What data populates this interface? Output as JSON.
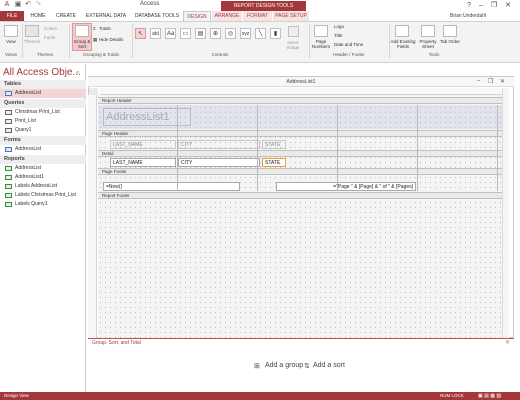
{
  "window": {
    "app_title": "Access",
    "tools_tab": "REPORT DESIGN TOOLS",
    "user": "Brian Underdahl",
    "help": "?"
  },
  "ribbon": {
    "tabs": [
      "FILE",
      "HOME",
      "CREATE",
      "EXTERNAL DATA",
      "DATABASE TOOLS",
      "DESIGN",
      "ARRANGE",
      "FORMAT",
      "PAGE SETUP"
    ],
    "groups": {
      "views": "Views",
      "themes": "Themes",
      "grouping": "Grouping & Totals",
      "controls": "Controls",
      "header_footer": "Header / Footer",
      "tools": "Tools"
    },
    "buttons": {
      "view": "View",
      "themes": "Themes",
      "colors": "Colors",
      "fonts": "Fonts",
      "group_sort": "Group & Sort",
      "totals": "Totals",
      "hide_details": "Hide Details",
      "insert_image": "Insert Image",
      "page_numbers": "Page Numbers",
      "logo": "Logo",
      "title": "Title",
      "date_time": "Date and Time",
      "add_fields": "Add Existing Fields",
      "property_sheet": "Property Sheet",
      "tab_order": "Tab Order"
    }
  },
  "nav": {
    "title": "All Access Obje...",
    "sections": [
      {
        "label": "Tables",
        "items": [
          "AddressList"
        ]
      },
      {
        "label": "Queries",
        "items": [
          "Christmas Print_List",
          "Print_List",
          "Query1"
        ]
      },
      {
        "label": "Forms",
        "items": [
          "AddressList"
        ]
      },
      {
        "label": "Reports",
        "items": [
          "AddressList",
          "AddressList1",
          "Labels AddressList",
          "Labels Christmas Print_List",
          "Labels Query1"
        ]
      }
    ]
  },
  "report": {
    "window_title": "AddressList1",
    "bands": {
      "report_header": "Report Header",
      "page_header": "Page Header",
      "detail": "Detail",
      "page_footer": "Page Footer",
      "report_footer": "Report Footer"
    },
    "header_title": "AddressList1",
    "labels": [
      "LAST_NAME",
      "CITY",
      "STATE"
    ],
    "fields": [
      "LAST_NAME",
      "CITY",
      "STATE"
    ],
    "footer_now": "=Now()",
    "footer_page": "=\"Page \" & [Page] & \" of \" & [Pages]"
  },
  "group_sort": {
    "title": "Group, Sort, and Total",
    "add_group": "Add a group",
    "add_sort": "Add a sort"
  },
  "status": {
    "left": "Design View",
    "right": "NUM LOCK"
  },
  "colors": {
    "accent": "#a4373a",
    "selection": "#f4d4d4"
  }
}
